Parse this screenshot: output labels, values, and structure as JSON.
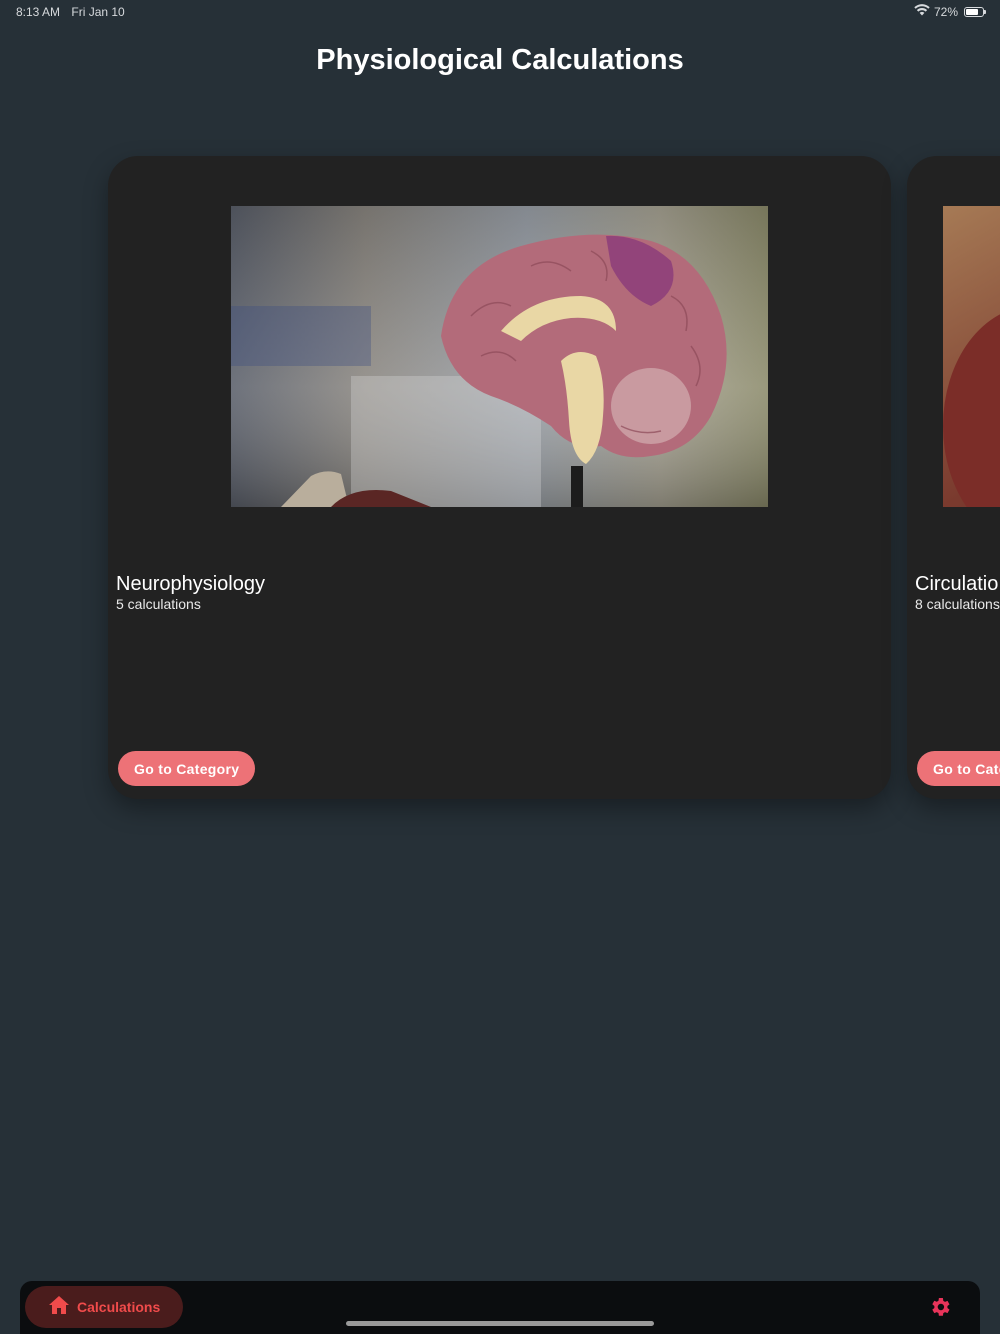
{
  "status_bar": {
    "time": "8:13 AM",
    "date": "Fri Jan 10",
    "battery_percent": "72%",
    "battery_level": 0.72,
    "icons": [
      "wifi-icon",
      "battery-icon"
    ]
  },
  "header": {
    "title": "Physiological Calculations"
  },
  "categories": [
    {
      "name": "Neurophysiology",
      "count": "5 calculations",
      "button_label": "Go to Category",
      "image": "brain-model-photo"
    },
    {
      "name": "Circulatio",
      "count": "8 calculations",
      "button_label": "Go to Cate",
      "image": "heart-model-photo"
    }
  ],
  "bottom_nav": {
    "active_tab": "Calculations",
    "active_icon": "home-icon",
    "settings_icon": "gear-icon"
  },
  "colors": {
    "background": "#263037",
    "card": "#222222",
    "accent_button": "#ed7277",
    "nav_active_text": "#f04b4b",
    "nav_active_pill": "#4a1c1c",
    "settings_icon": "#e8345a"
  }
}
